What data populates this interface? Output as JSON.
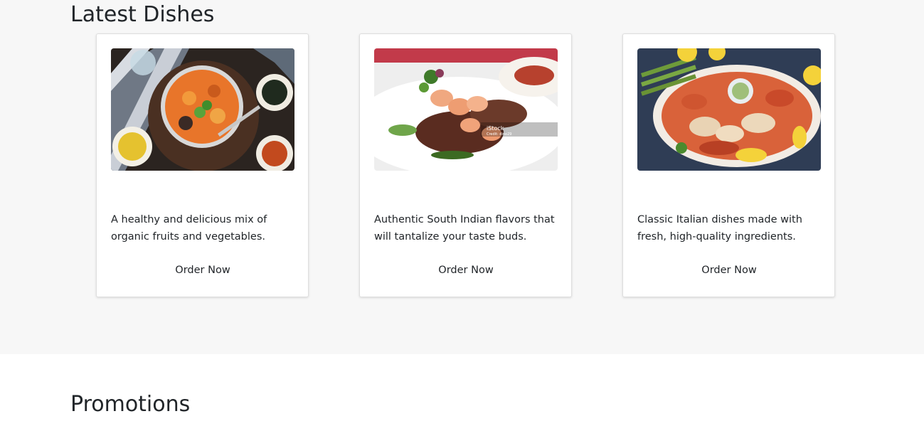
{
  "latest": {
    "title": "Latest Dishes",
    "cards": [
      {
        "image_icon": "seafood-stew-bowl-photo",
        "text": "A healthy and delicious mix of organic fruits and vegetables.",
        "button_label": "Order Now"
      },
      {
        "image_icon": "grilled-shrimp-steak-plate-photo",
        "text": "Authentic South Indian flavors that will tantalize your taste buds.",
        "button_label": "Order Now",
        "watermark": "iStock",
        "watermark_credit": "Credit: dino29"
      },
      {
        "image_icon": "seafood-platter-photo",
        "text": "Classic Italian dishes made with fresh, high-quality ingredients.",
        "button_label": "Order Now"
      }
    ]
  },
  "promotions": {
    "title": "Promotions"
  },
  "colors": {
    "section_bg": "#f7f7f7",
    "card_bg": "#ffffff",
    "text": "#212529"
  }
}
